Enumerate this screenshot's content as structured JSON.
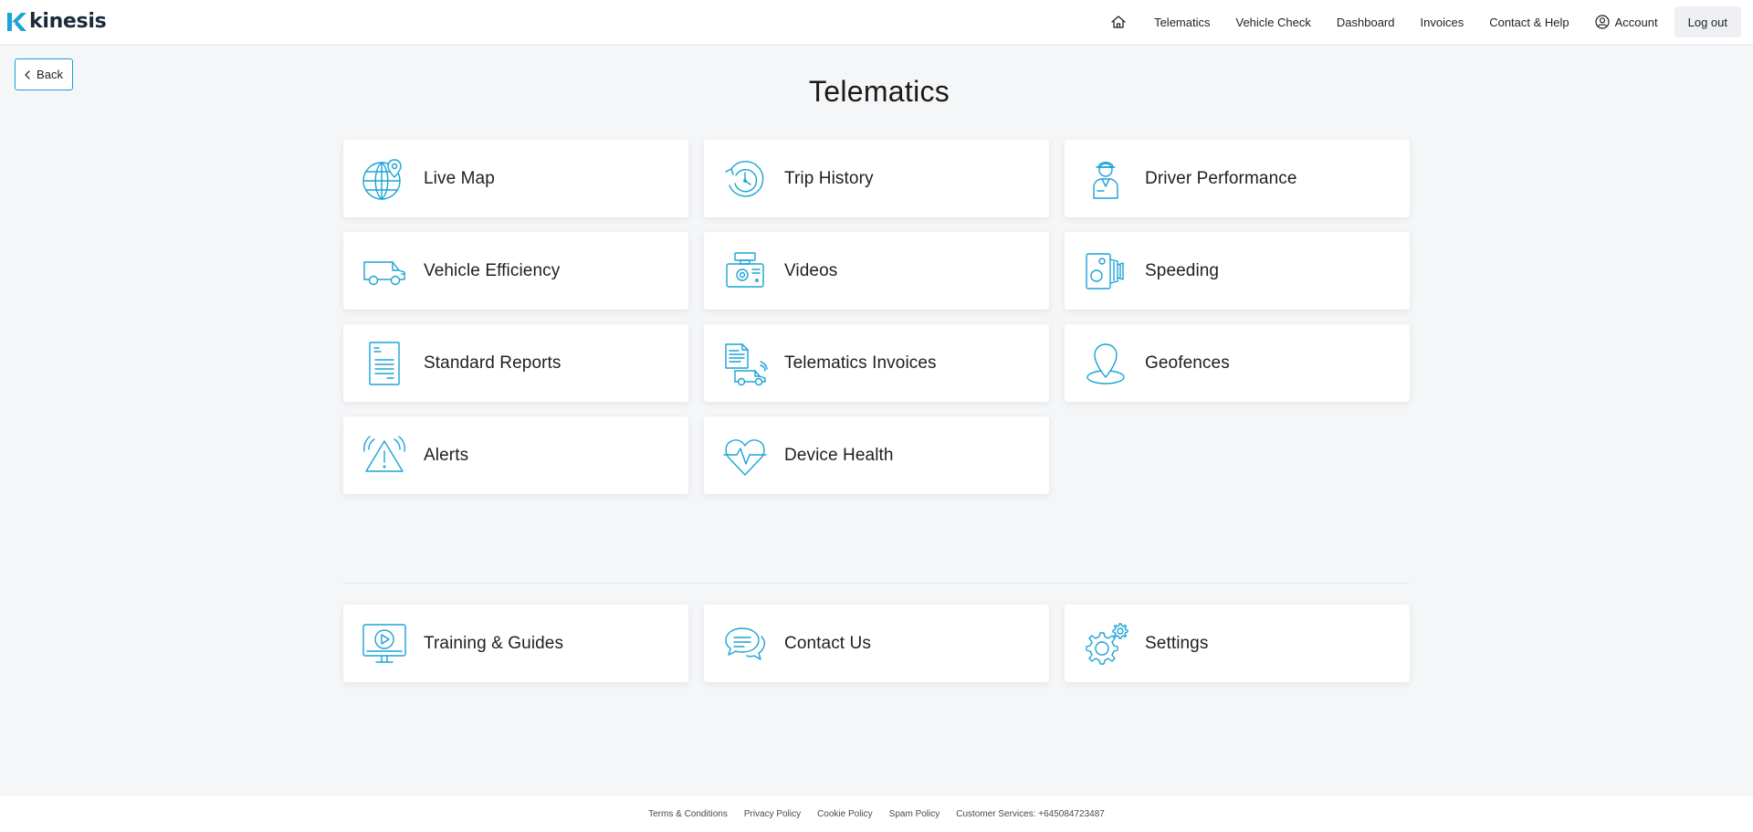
{
  "brand": {
    "name": "kinesis",
    "accent": "#1aa3d6",
    "text": "#1b2a3a"
  },
  "nav": {
    "home_icon": "home-icon",
    "items": [
      "Telematics",
      "Vehicle Check",
      "Dashboard",
      "Invoices",
      "Contact & Help"
    ],
    "account": "Account",
    "logout": "Log out"
  },
  "back": {
    "label": "Back"
  },
  "page": {
    "title": "Telematics"
  },
  "tiles": [
    {
      "label": "Live Map",
      "icon": "globe-pin-icon"
    },
    {
      "label": "Trip History",
      "icon": "history-icon"
    },
    {
      "label": "Driver Performance",
      "icon": "driver-icon"
    },
    {
      "label": "Vehicle Efficiency",
      "icon": "van-icon"
    },
    {
      "label": "Videos",
      "icon": "dashcam-icon"
    },
    {
      "label": "Speeding",
      "icon": "speed-camera-icon"
    },
    {
      "label": "Standard Reports",
      "icon": "report-icon"
    },
    {
      "label": "Telematics Invoices",
      "icon": "invoice-van-icon"
    },
    {
      "label": "Geofences",
      "icon": "geofence-pin-icon"
    },
    {
      "label": "Alerts",
      "icon": "alert-icon"
    },
    {
      "label": "Device Health",
      "icon": "heartbeat-icon"
    }
  ],
  "bottom_tiles": [
    {
      "label": "Training & Guides",
      "icon": "video-monitor-icon"
    },
    {
      "label": "Contact Us",
      "icon": "chat-icon"
    },
    {
      "label": "Settings",
      "icon": "gear-icon"
    }
  ],
  "footer": {
    "links": [
      "Terms & Conditions",
      "Privacy Policy",
      "Cookie Policy",
      "Spam Policy"
    ],
    "customer_services": "Customer Services: +645084723487"
  }
}
